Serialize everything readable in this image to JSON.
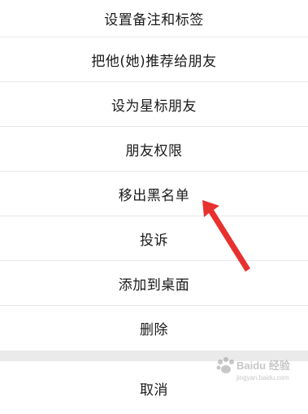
{
  "menu": {
    "items": [
      {
        "label": "设置备注和标签"
      },
      {
        "label": "把他(她)推荐给朋友"
      },
      {
        "label": "设为星标朋友"
      },
      {
        "label": "朋友权限"
      },
      {
        "label": "移出黑名单"
      },
      {
        "label": "投诉"
      },
      {
        "label": "添加到桌面"
      },
      {
        "label": "删除"
      }
    ],
    "cancel_label": "取消"
  },
  "annotation": {
    "arrow_color": "#e8312f"
  },
  "watermark": {
    "text": "Baidu 经验",
    "subtext": "jingyan.baidu.com"
  }
}
